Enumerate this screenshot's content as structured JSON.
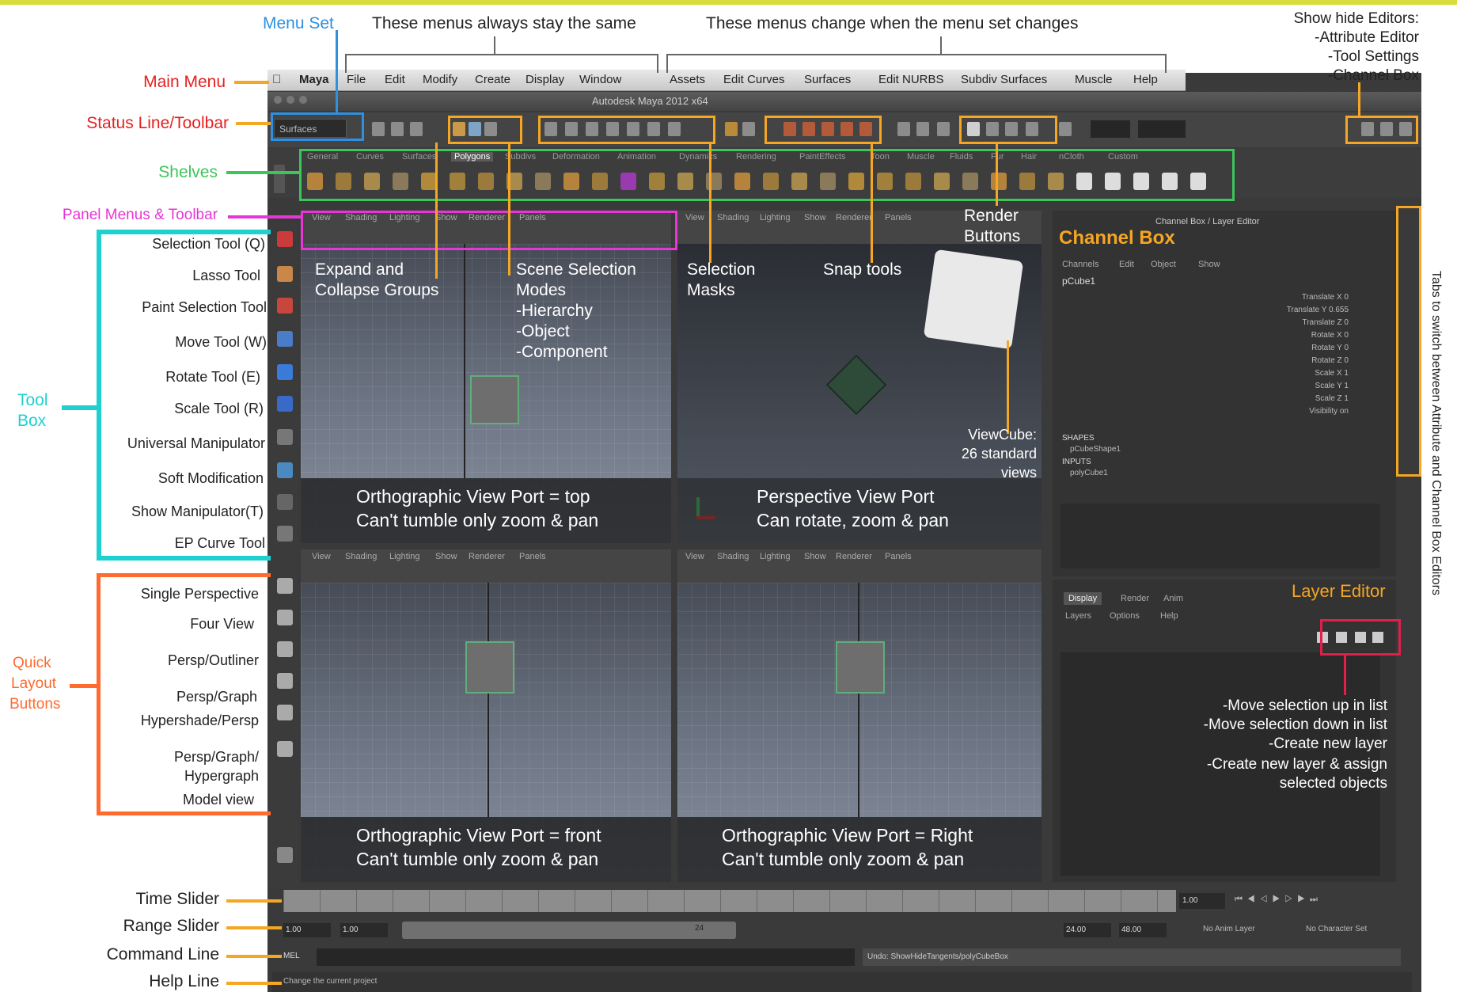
{
  "annotations": {
    "menu_set": "Menu Set",
    "menus_stay": "These menus always stay the same",
    "menus_change": "These menus change when the menu set changes",
    "show_hide": [
      "Show hide Editors:",
      "-Attribute Editor",
      "-Tool Settings",
      "-Channel Box"
    ],
    "main_menu": "Main Menu",
    "status_line": "Status Line/Toolbar",
    "shelves": "Shelves",
    "panel_menus": "Panel Menus & Toolbar",
    "tool_box": [
      "Tool",
      "Box"
    ],
    "quick_layout": [
      "Quick",
      "Layout",
      "Buttons"
    ],
    "tools": [
      "Selection Tool (Q)",
      "Lasso Tool",
      "Paint Selection Tool",
      "Move Tool (W)",
      "Rotate Tool (E)",
      "Scale Tool (R)",
      "Universal Manipulator",
      "Soft Modification",
      "Show Manipulator(T)",
      "EP Curve Tool"
    ],
    "layouts": [
      "Single Perspective",
      "Four View",
      "Persp/Outliner",
      "Persp/Graph",
      "Hypershade/Persp",
      "Persp/Graph/",
      "Hypergraph",
      "Model view"
    ],
    "time_slider": "Time Slider",
    "range_slider": "Range Slider",
    "command_line": "Command Line",
    "help_line": "Help Line",
    "expand_collapse": [
      "Expand and",
      "Collapse Groups"
    ],
    "scene_selection": [
      "Scene Selection",
      "Modes",
      "-Hierarchy",
      "-Object",
      "-Component"
    ],
    "selection_masks": [
      "Selection",
      "Masks"
    ],
    "snap_tools": "Snap tools",
    "render_buttons": [
      "Render",
      "Buttons"
    ],
    "channel_box": "Channel Box",
    "layer_editor": "Layer Editor",
    "viewcube": [
      "ViewCube:",
      "26 standard",
      "views"
    ],
    "layer_ops": [
      "-Move selection up in list",
      "-Move selection down in list",
      "-Create new layer",
      "-Create new layer & assign",
      "selected objects"
    ],
    "tabs_switch": "Tabs to switch between Attribute and Channel Box Editors"
  },
  "menubar": {
    "apple": "",
    "items": [
      "Maya",
      "File",
      "Edit",
      "Modify",
      "Create",
      "Display",
      "Window",
      "Assets",
      "Edit Curves",
      "Surfaces",
      "Edit NURBS",
      "Subdiv Surfaces",
      "Muscle",
      "Help"
    ]
  },
  "window_title": "Autodesk Maya 2012 x64",
  "status_line": {
    "menu_set_value": "Surfaces"
  },
  "shelf_tabs": [
    "General",
    "Curves",
    "Surfaces",
    "Polygons",
    "Subdivs",
    "Deformation",
    "Animation",
    "Dynamics",
    "Rendering",
    "PaintEffects",
    "Toon",
    "Muscle",
    "Fluids",
    "Fur",
    "Hair",
    "nCloth",
    "Custom"
  ],
  "panel_menu_items": [
    "View",
    "Shading",
    "Lighting",
    "Show",
    "Renderer",
    "Panels"
  ],
  "viewports": {
    "top": [
      "Orthographic View Port = top",
      "Can't tumble only zoom & pan"
    ],
    "persp": [
      "Perspective View Port",
      "Can rotate, zoom & pan"
    ],
    "front": [
      "Orthographic View Port = front",
      "Can't tumble only zoom & pan"
    ],
    "right": [
      "Orthographic View Port = Right",
      "Can't tumble only zoom & pan"
    ]
  },
  "channel_box": {
    "header": "Channel Box / Layer Editor",
    "menus": [
      "Channels",
      "Edit",
      "Object",
      "Show"
    ],
    "object": "pCube1",
    "attrs": [
      "Translate X 0",
      "Translate Y 0.655",
      "Translate Z 0",
      "Rotate X 0",
      "Rotate Y 0",
      "Rotate Z 0",
      "Scale X 1",
      "Scale Y 1",
      "Scale Z 1",
      "Visibility on"
    ],
    "shapes_label": "SHAPES",
    "shape": "pCubeShape1",
    "inputs_label": "INPUTS",
    "input": "polyCube1"
  },
  "layer_editor": {
    "tabs": [
      "Display",
      "Render",
      "Anim"
    ],
    "menus": [
      "Layers",
      "Options",
      "Help"
    ]
  },
  "range": {
    "start": "1.00",
    "start2": "1.00",
    "mark": "24",
    "end": "24.00",
    "end2": "48.00",
    "current": "1.00"
  },
  "anim_layer": "No Anim Layer",
  "char_set": "No Character Set",
  "command": {
    "label": "MEL",
    "result": "Undo: ShowHideTangents/polyCubeBox"
  },
  "help_text": "Change the current project",
  "colors": {
    "yellow": "#f5a623",
    "blue": "#2f8fe0",
    "red": "#e62020",
    "green": "#3cc55a",
    "magenta": "#e835d6",
    "cyan": "#1fd0d0",
    "orange": "#ff6a2f",
    "crimson": "#e0204a"
  }
}
